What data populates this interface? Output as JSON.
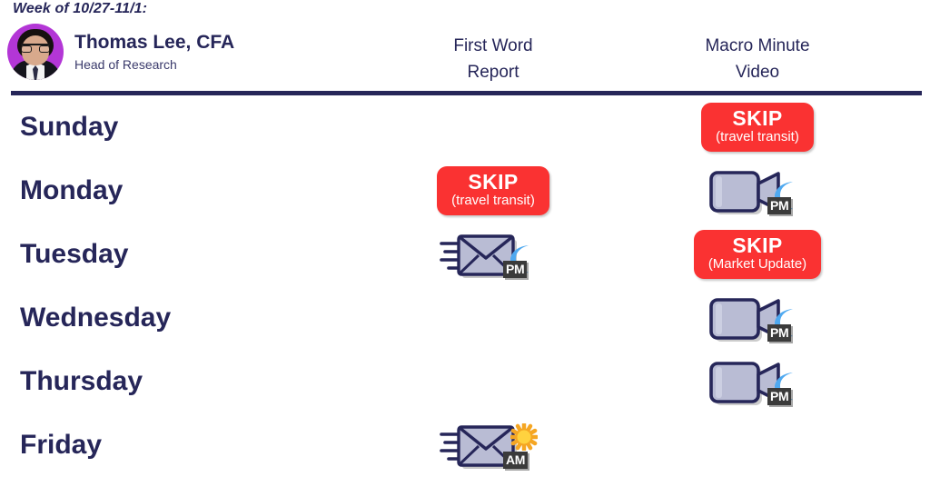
{
  "header": {
    "week_label": "Week of 10/27-11/1:",
    "analyst_name": "Thomas Lee, CFA",
    "analyst_role": "Head of Research",
    "avatar_alt": "analyst-portrait",
    "columns": [
      {
        "id": "first-word",
        "label": "First Word\nReport"
      },
      {
        "id": "macro",
        "label": "Macro Minute\nVideo"
      }
    ],
    "column_first_word_line1": "First Word",
    "column_first_word_line2": "Report",
    "column_macro_line1": "Macro Minute",
    "column_macro_line2": "Video"
  },
  "colors": {
    "navy": "#262659",
    "skip_red": "#fa3232",
    "avatar_bg": "#b336d6",
    "moon_blue": "#4fa9f0",
    "sun_orange": "#f5a623",
    "tag_gray": "#3b3b3b",
    "envelope_fill": "#b9bcd4",
    "camera_fill": "#b9bcd4"
  },
  "rows": [
    {
      "day": "Sunday",
      "first_word": {
        "type": "none"
      },
      "macro": {
        "type": "skip",
        "title": "SKIP",
        "reason": "(travel transit)"
      }
    },
    {
      "day": "Monday",
      "first_word": {
        "type": "skip",
        "title": "SKIP",
        "reason": "(travel transit)"
      },
      "macro": {
        "type": "video",
        "time_of_day": "PM",
        "symbol": "moon-icon"
      }
    },
    {
      "day": "Tuesday",
      "first_word": {
        "type": "email",
        "time_of_day": "PM",
        "symbol": "moon-icon"
      },
      "macro": {
        "type": "skip",
        "title": "SKIP",
        "reason": "(Market Update)"
      }
    },
    {
      "day": "Wednesday",
      "first_word": {
        "type": "none"
      },
      "macro": {
        "type": "video",
        "time_of_day": "PM",
        "symbol": "moon-icon"
      }
    },
    {
      "day": "Thursday",
      "first_word": {
        "type": "none"
      },
      "macro": {
        "type": "video",
        "time_of_day": "PM",
        "symbol": "moon-icon"
      }
    },
    {
      "day": "Friday",
      "first_word": {
        "type": "email",
        "time_of_day": "AM",
        "symbol": "sun-icon"
      },
      "macro": {
        "type": "none"
      }
    }
  ]
}
